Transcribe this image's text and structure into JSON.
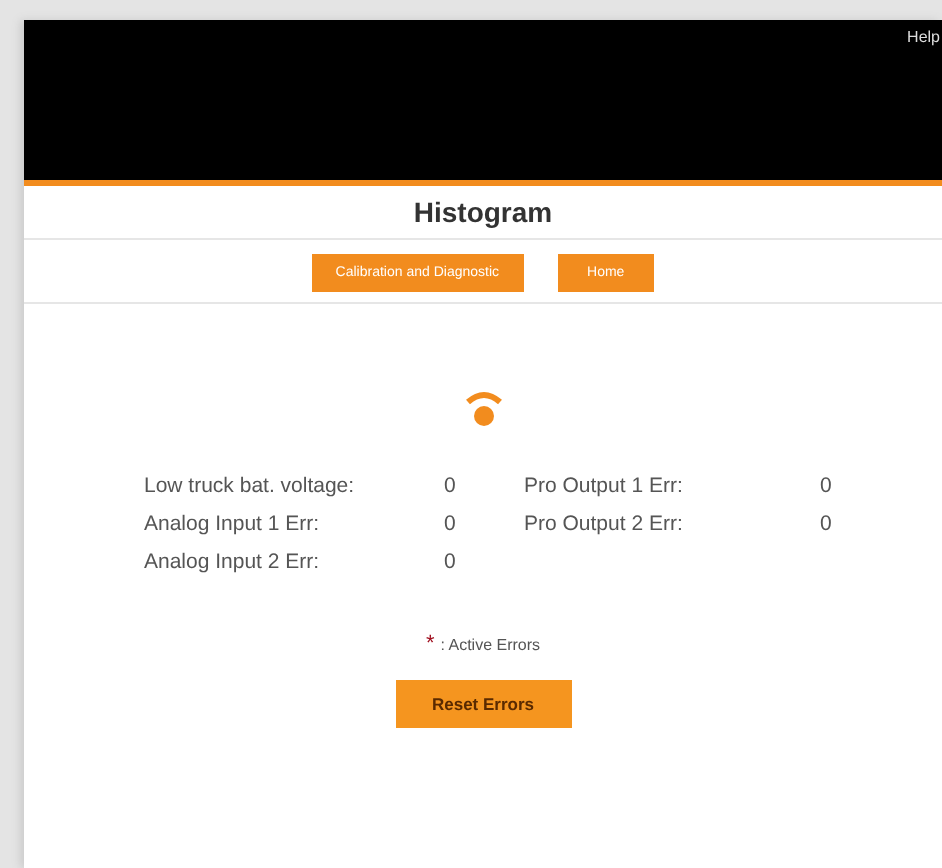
{
  "header": {
    "help_link": "Help"
  },
  "title": "Histogram",
  "nav_buttons": [
    "Calibration and Diagnostic",
    "Home"
  ],
  "errors": {
    "column_1": [
      {
        "label": "Low truck bat. voltage:",
        "value": "0"
      },
      {
        "label": "Analog Input 1 Err:",
        "value": "0"
      },
      {
        "label": "Analog Input 2 Err:",
        "value": "0"
      }
    ],
    "column_2": [
      {
        "label": "Pro Output 1 Err:",
        "value": "0"
      },
      {
        "label": "Pro Output 2 Err:",
        "value": "0"
      }
    ]
  },
  "legend": {
    "mark": "*",
    "text": ": Active Errors"
  },
  "reset_button": "Reset Errors"
}
